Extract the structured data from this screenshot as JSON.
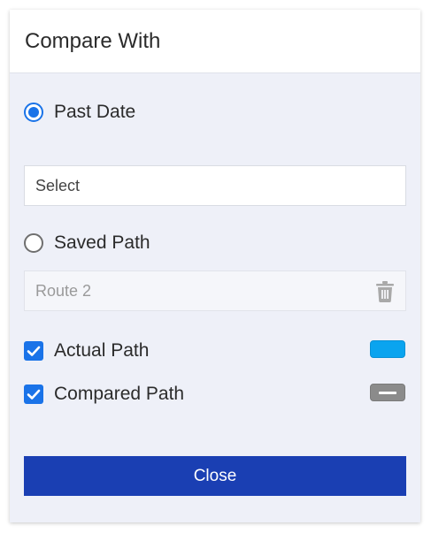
{
  "dialog": {
    "title": "Compare With"
  },
  "options": {
    "past_date": {
      "label": "Past Date",
      "selected": true
    },
    "saved_path": {
      "label": "Saved Path",
      "selected": false
    }
  },
  "date_select": {
    "value": "Select"
  },
  "saved_route": {
    "value": "Route 2",
    "delete_icon": "trash-icon"
  },
  "paths": {
    "actual": {
      "label": "Actual Path",
      "checked": true,
      "color": "#0aa4ef"
    },
    "compared": {
      "label": "Compared Path",
      "checked": true,
      "color": "#8b8b8b"
    }
  },
  "footer": {
    "close_label": "Close",
    "close_color": "#1a3fb3"
  },
  "accent": "#1a73e8"
}
